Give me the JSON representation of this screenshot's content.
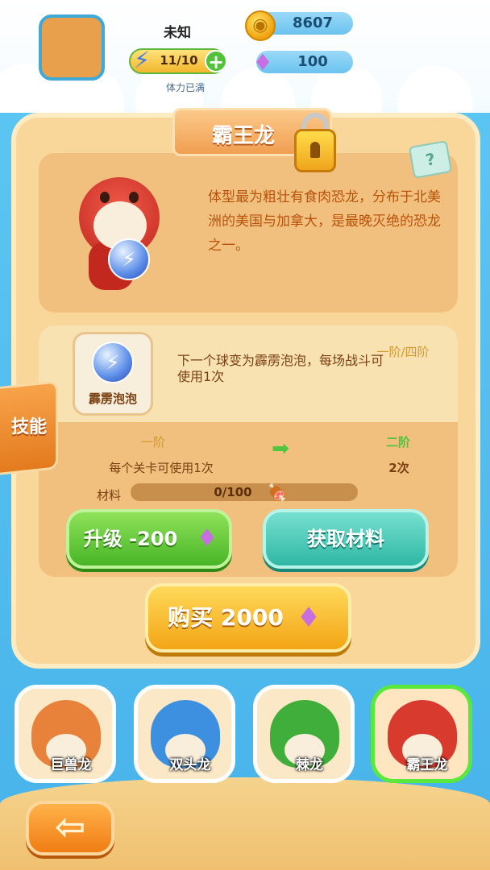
{
  "header": {
    "player_name": "未知",
    "energy": "11/10",
    "energy_status": "体力已满",
    "coins": "8607",
    "gems": "100"
  },
  "dino": {
    "name": "霸王龙",
    "description": "体型最为粗壮有食肉恐龙，分布于北美洲的美国与加拿大，是最晚灭绝的恐龙之一。"
  },
  "skill": {
    "tab_label": "技能",
    "name": "霹雳泡泡",
    "description": "下一个球变为霹雳泡泡，每场战斗可使用1次",
    "tier_progress": "一阶/四阶",
    "current_tier_label": "一阶",
    "next_tier_label": "二阶",
    "current_tier_value": "每个关卡可使用1次",
    "next_tier_value": "2次",
    "material_label": "材料",
    "material_progress": "0/100",
    "material_fraction": 0
  },
  "buttons": {
    "upgrade": "升级 -200",
    "get_material": "获取材料",
    "buy": "购买 2000"
  },
  "roster": [
    {
      "name": "巨兽龙",
      "color": "#e8823a",
      "selected": false
    },
    {
      "name": "双头龙",
      "color": "#3d8fe0",
      "selected": false
    },
    {
      "name": "棘龙",
      "color": "#3fae3a",
      "selected": false
    },
    {
      "name": "霸王龙",
      "color": "#d83a2e",
      "selected": true
    }
  ],
  "colors": {
    "accent_orange": "#f09f51",
    "green_button": "#48b526",
    "teal_button": "#2fb7a4",
    "gold_button": "#f3a515"
  },
  "icons": {
    "energy": "lightning-icon",
    "coin": "coin-icon",
    "gem": "gem-icon",
    "lock": "lock-icon",
    "help": "help-book-icon",
    "material": "meat-icon",
    "back": "back-arrow-icon"
  }
}
